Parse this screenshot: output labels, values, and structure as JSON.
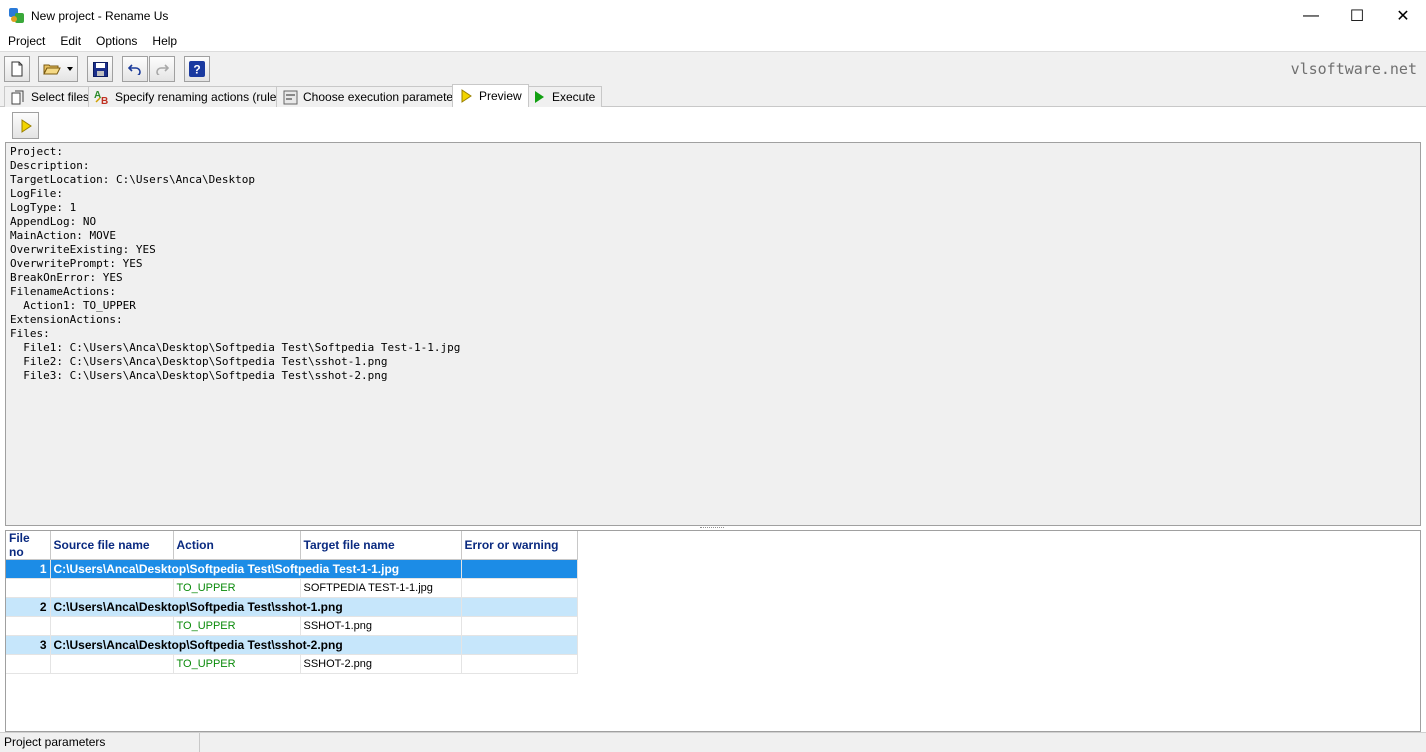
{
  "window": {
    "title": "New project - Rename Us",
    "controls": {
      "minimize": "—",
      "maximize": "☐",
      "close": "✕"
    }
  },
  "menu": [
    "Project",
    "Edit",
    "Options",
    "Help"
  ],
  "toolbar": {
    "buttons": [
      "new-file-icon",
      "open-folder-icon",
      "save-icon",
      "undo-icon",
      "redo-icon",
      "help-icon"
    ],
    "help_glyph": "?",
    "brand": "vlsoftware.net"
  },
  "tabs": [
    {
      "label": "Select files",
      "icon": "files-icon"
    },
    {
      "label": "Specify renaming actions (rules)",
      "icon": "ab-rules-icon"
    },
    {
      "label": "Choose execution parameters",
      "icon": "parameters-icon"
    },
    {
      "label": "Preview",
      "icon": "preview-arrow-icon",
      "active": true
    },
    {
      "label": "Execute",
      "icon": "execute-play-icon"
    }
  ],
  "params_text": "Project:\nDescription:\nTargetLocation: C:\\Users\\Anca\\Desktop\nLogFile:\nLogType: 1\nAppendLog: NO\nMainAction: MOVE\nOverwriteExisting: YES\nOverwritePrompt: YES\nBreakOnError: YES\nFilenameActions:\n  Action1: TO_UPPER\nExtensionActions:\nFiles:\n  File1: C:\\Users\\Anca\\Desktop\\Softpedia Test\\Softpedia Test-1-1.jpg\n  File2: C:\\Users\\Anca\\Desktop\\Softpedia Test\\sshot-1.png\n  File3: C:\\Users\\Anca\\Desktop\\Softpedia Test\\sshot-2.png",
  "grid": {
    "columns": [
      "File no",
      "Source file name",
      "Action",
      "Target file name",
      "Error or warning"
    ],
    "rows": [
      {
        "no": "1",
        "source": "C:\\Users\\Anca\\Desktop\\Softpedia Test\\Softpedia Test-1-1.jpg",
        "action": "TO_UPPER",
        "target": "SOFTPEDIA TEST-1-1.jpg",
        "error": ""
      },
      {
        "no": "2",
        "source": "C:\\Users\\Anca\\Desktop\\Softpedia Test\\sshot-1.png",
        "action": "TO_UPPER",
        "target": "SSHOT-1.png",
        "error": ""
      },
      {
        "no": "3",
        "source": "C:\\Users\\Anca\\Desktop\\Softpedia Test\\sshot-2.png",
        "action": "TO_UPPER",
        "target": "SSHOT-2.png",
        "error": ""
      }
    ]
  },
  "status": {
    "text": "Project parameters",
    "right": ""
  }
}
